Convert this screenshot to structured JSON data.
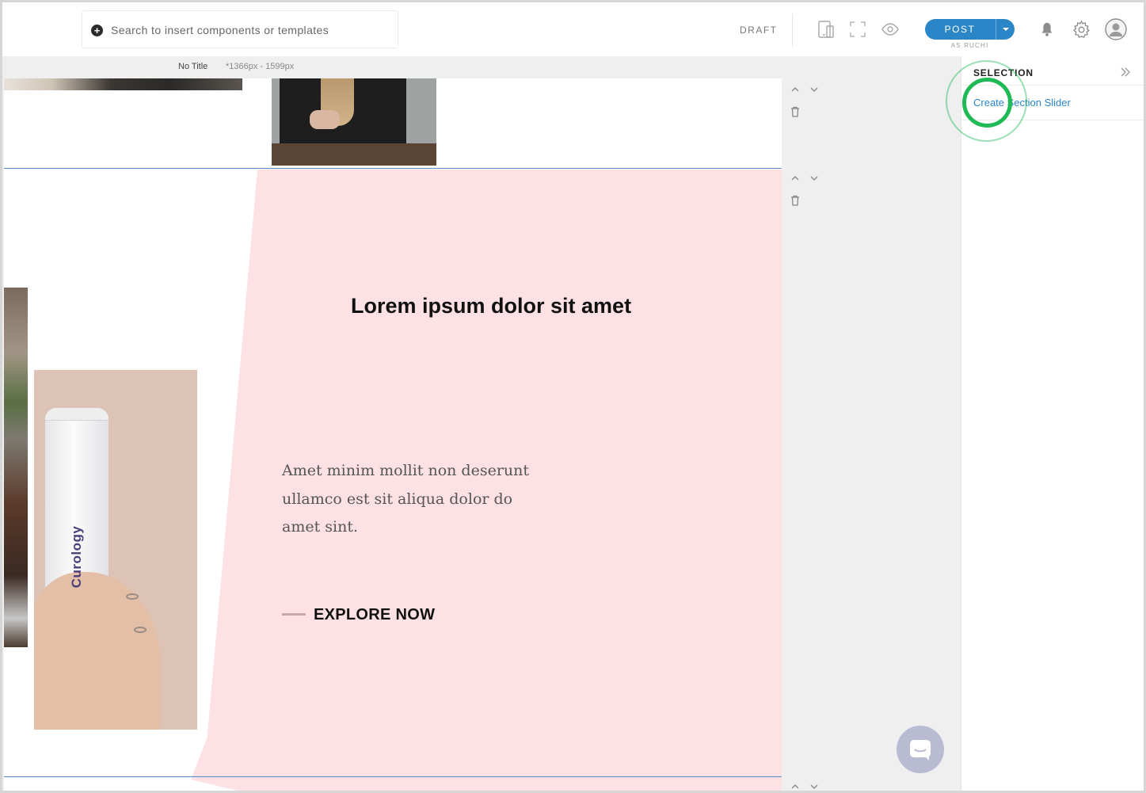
{
  "toolbar": {
    "search_placeholder": "Search to insert components or templates",
    "status": "DRAFT",
    "post_label": "POST",
    "post_as": "AS RUCHI"
  },
  "canvas": {
    "page_title": "No Title",
    "page_size": "*1366px - 1599px"
  },
  "hero": {
    "title": "Lorem ipsum dolor sit amet",
    "body": "Amet minim mollit non deserunt ullamco est sit aliqua dolor do amet sint.",
    "cta": "EXPLORE NOW",
    "background": "#fde1e5"
  },
  "product_image": {
    "brand_text": "Curology"
  },
  "panel": {
    "title": "SELECTION",
    "link": "Create Section Slider"
  },
  "colors": {
    "accent": "#2a86c6",
    "highlight": "#1fb955",
    "section_line": "#5b8dc9"
  },
  "icons": [
    "plus-icon",
    "devices-icon",
    "fullscreen-icon",
    "preview-eye-icon",
    "bell-icon",
    "gear-icon",
    "avatar-icon",
    "chevron-up-icon",
    "chevron-down-icon",
    "trash-icon",
    "double-chevron-right-icon",
    "chat-icon"
  ]
}
